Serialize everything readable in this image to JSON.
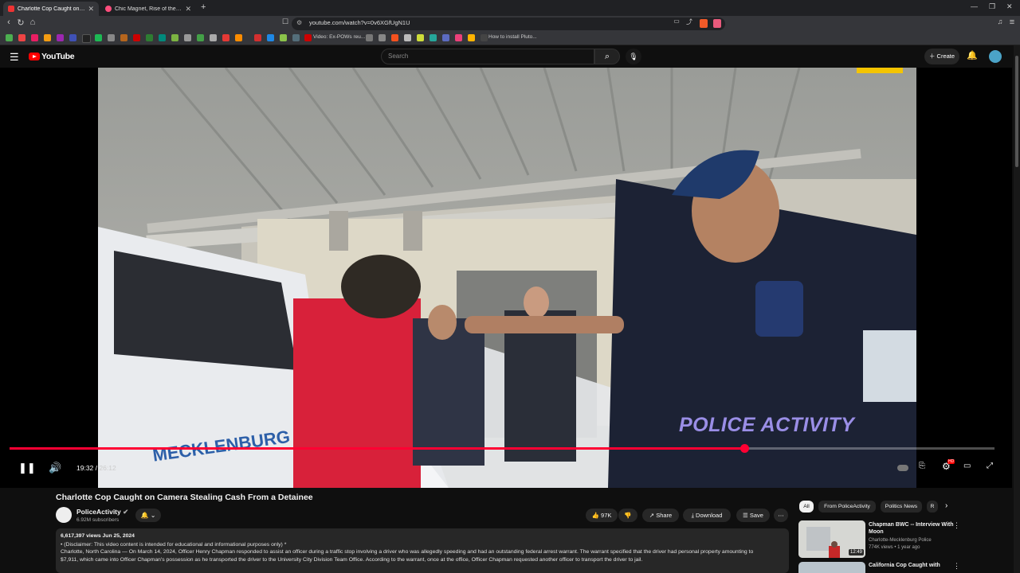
{
  "browser": {
    "tabs": [
      {
        "label": "Charlotte Cop Caught on Camera"
      },
      {
        "label": "Chic Magnet, Rise of the warrior wom"
      }
    ],
    "new_tab": "+",
    "url": "youtube.com/watch?v=0v6XGfUgN1U",
    "bookmark_text_1": "Video: Ex-POWs reu...",
    "bookmark_text_2": "How to install Pluto..."
  },
  "youtube": {
    "logo_text": "YouTube",
    "search_placeholder": "Search",
    "create_label": "Create"
  },
  "video": {
    "watermark": "POLICE ACTIVITY",
    "car_text": "MECKLENBURG",
    "current_time": "19:32",
    "duration": "26:12",
    "time_separator": "/",
    "progress": 0.746,
    "settings_badge": "HD"
  },
  "info": {
    "title": "Charlotte Cop Caught on Camera Stealing Cash From a Detainee",
    "channel_name": "PoliceActivity",
    "subscribers": "6.92M subscribers",
    "likes": "97K",
    "share_label": "Share",
    "download_label": "Download",
    "save_label": "Save",
    "views_date": "6,617,397 views  Jun 25, 2024",
    "desc_line1": "• (Disclaimer: This video content is intended for educational and informational purposes only) *",
    "desc_line2": "Charlotte, North Carolina — On March 14, 2024, Officer Henry Chapman responded to assist an officer during a traffic stop involving a driver who was allegedly speeding and had an outstanding federal arrest warrant. The warrant specified that the driver had personal property amounting to",
    "desc_line3": "$7,911, which came into Officer Chapman's possession as he transported the driver to the University City Division Team Office. According to the warrant, once at the office, Officer Chapman requested another officer to transport the driver to jail."
  },
  "sidebar": {
    "chips": [
      {
        "label": "All"
      },
      {
        "label": "From PoliceActivity"
      },
      {
        "label": "Politics News"
      },
      {
        "label": "R"
      }
    ],
    "videos": [
      {
        "title": "Chapman BWC -- Interview With Moon",
        "channel": "Charlotte-Mecklenburg Police",
        "meta": "774K views • 1 year ago",
        "duration": "12:49"
      },
      {
        "title": "California Cop Caught with",
        "channel": "",
        "meta": "",
        "duration": ""
      }
    ]
  },
  "colors": {
    "progress": "#ff0033",
    "yt_red": "#ff0000",
    "background": "#0f0f0f"
  }
}
